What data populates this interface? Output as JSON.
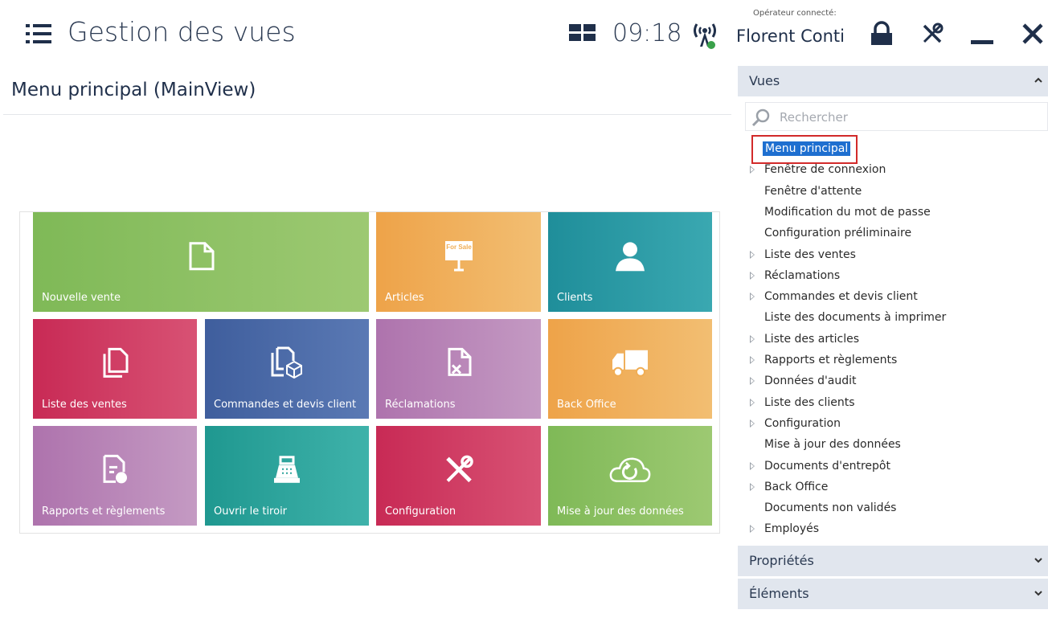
{
  "header": {
    "title": "Gestion des vues",
    "clock": "09:18",
    "operator_caption": "Opérateur connecté:",
    "operator_name": "Florent Conti"
  },
  "main": {
    "view_title": "Menu principal (MainView)",
    "for_sale_sign": "For Sale",
    "tiles": [
      {
        "label": "Nouvelle vente",
        "color": "#8cc063",
        "icon": "new-document-icon"
      },
      {
        "label": "Articles",
        "color": "#f0ad54",
        "icon": "for-sale-sign-icon"
      },
      {
        "label": "Clients",
        "color": "#2a9aa4",
        "icon": "person-icon"
      },
      {
        "label": "Liste des ventes",
        "color": "#d0385e",
        "icon": "documents-icon"
      },
      {
        "label": "Commandes et devis client",
        "color": "#4b6aa8",
        "icon": "documents-package-icon"
      },
      {
        "label": "Réclamations",
        "color": "#b77fb6",
        "icon": "document-cancel-icon"
      },
      {
        "label": "Back Office",
        "color": "#f0ad54",
        "icon": "truck-icon"
      },
      {
        "label": "Rapports et règlements",
        "color": "#b77fb6",
        "icon": "report-icon"
      },
      {
        "label": "Ouvrir le tiroir",
        "color": "#2aa39b",
        "icon": "cash-register-icon"
      },
      {
        "label": "Configuration",
        "color": "#d0385e",
        "icon": "tools-icon"
      },
      {
        "label": "Mise à jour des données",
        "color": "#8cc063",
        "icon": "cloud-sync-icon"
      }
    ]
  },
  "sidebar": {
    "views_header": "Vues",
    "search_placeholder": "Rechercher",
    "items": [
      {
        "label": "Menu principal",
        "expandable": false,
        "selected": true
      },
      {
        "label": "Fenêtre de connexion",
        "expandable": true
      },
      {
        "label": "Fenêtre d'attente",
        "expandable": false
      },
      {
        "label": "Modification du mot de passe",
        "expandable": false
      },
      {
        "label": "Configuration préliminaire",
        "expandable": false
      },
      {
        "label": "Liste des ventes",
        "expandable": true
      },
      {
        "label": "Réclamations",
        "expandable": true
      },
      {
        "label": "Commandes et devis client",
        "expandable": true
      },
      {
        "label": "Liste des documents à imprimer",
        "expandable": false
      },
      {
        "label": "Liste des articles",
        "expandable": true
      },
      {
        "label": "Rapports et règlements",
        "expandable": true
      },
      {
        "label": "Données d'audit",
        "expandable": true
      },
      {
        "label": "Liste des clients",
        "expandable": true
      },
      {
        "label": "Configuration",
        "expandable": true
      },
      {
        "label": "Mise à jour des données",
        "expandable": false
      },
      {
        "label": "Documents d'entrepôt",
        "expandable": true
      },
      {
        "label": "Back Office",
        "expandable": true
      },
      {
        "label": "Documents non validés",
        "expandable": false
      },
      {
        "label": "Employés",
        "expandable": true
      }
    ],
    "properties_header": "Propriétés",
    "elements_header": "Éléments"
  }
}
